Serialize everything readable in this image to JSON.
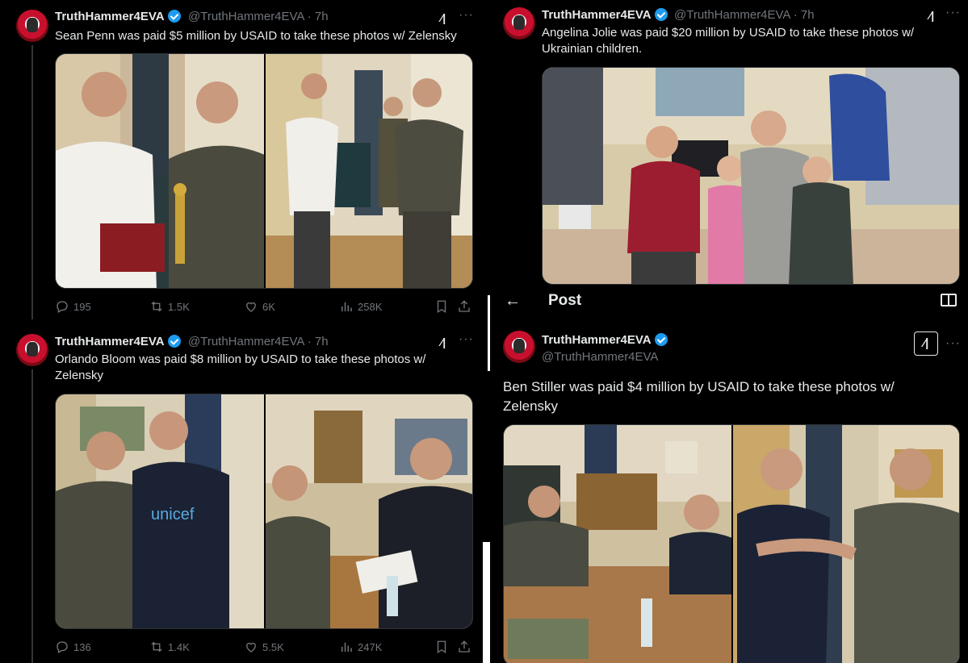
{
  "tweets": [
    {
      "name": "TruthHammer4EVA",
      "handle": "@TruthHammer4EVA · 7h",
      "text": "Sean Penn was paid $5 million by USAID to take these photos w/ Zelensky",
      "stats": {
        "replies": "195",
        "reposts": "1.5K",
        "likes": "6K",
        "views": "258K"
      }
    },
    {
      "name": "TruthHammer4EVA",
      "handle": "@TruthHammer4EVA · 7h",
      "text": "Orlando Bloom was paid $8 million by USAID to take these photos w/ Zelensky",
      "stats": {
        "replies": "136",
        "reposts": "1.4K",
        "likes": "5.5K",
        "views": "247K"
      }
    },
    {
      "name": "TruthHammer4EVA",
      "handle": "@TruthHammer4EVA · 7h",
      "text": "Angelina Jolie was paid $20 million by USAID to take these photos w/ Ukrainian children."
    },
    {
      "name": "TruthHammer4EVA",
      "handle": "@TruthHammer4EVA",
      "text": "Ben Stiller was paid $4 million by USAID to take these photos w/ Zelensky"
    }
  ],
  "post_header": {
    "title": "Post"
  },
  "icons": [
    "reply-icon",
    "repost-icon",
    "like-icon",
    "views-icon",
    "bookmark-icon",
    "share-icon",
    "grok-icon",
    "more-icon",
    "back-arrow-icon",
    "reader-icon",
    "verified-icon"
  ],
  "colors": {
    "background": "#000000",
    "text": "#e7e9ea",
    "muted": "#71767b",
    "verified": "#1d9bf0"
  }
}
